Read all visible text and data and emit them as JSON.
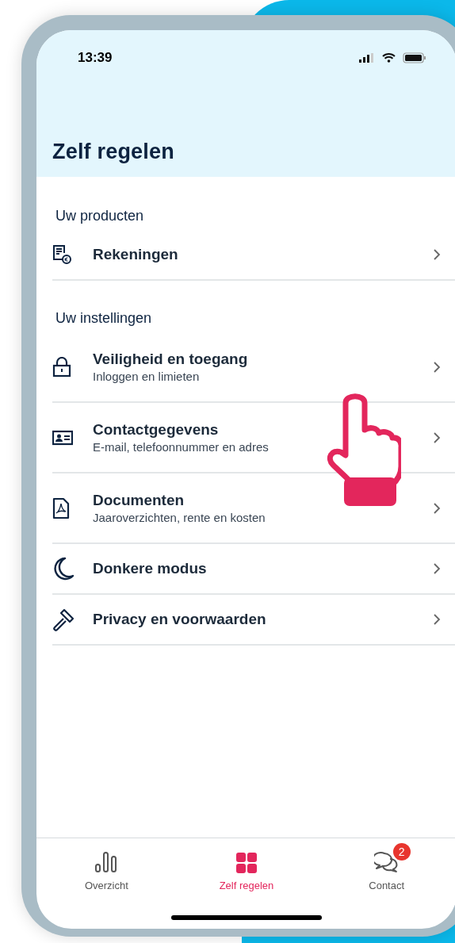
{
  "status_bar": {
    "time": "13:39"
  },
  "title": "Zelf regelen",
  "sections": [
    {
      "heading": "Uw producten",
      "items": [
        {
          "title": "Rekeningen"
        }
      ]
    },
    {
      "heading": "Uw instellingen",
      "items": [
        {
          "title": "Veiligheid en toegang",
          "subtitle": "Inloggen en limieten"
        },
        {
          "title": "Contactgegevens",
          "subtitle": "E-mail, telefoonnummer en adres"
        },
        {
          "title": "Documenten",
          "subtitle": "Jaaroverzichten, rente en kosten"
        },
        {
          "title": "Donkere modus"
        },
        {
          "title": "Privacy en voorwaarden"
        }
      ]
    }
  ],
  "tab_bar": [
    {
      "label": "Overzicht",
      "selected": false
    },
    {
      "label": "Zelf regelen",
      "selected": true
    },
    {
      "label": "Contact",
      "selected": false,
      "badge": "2"
    }
  ]
}
